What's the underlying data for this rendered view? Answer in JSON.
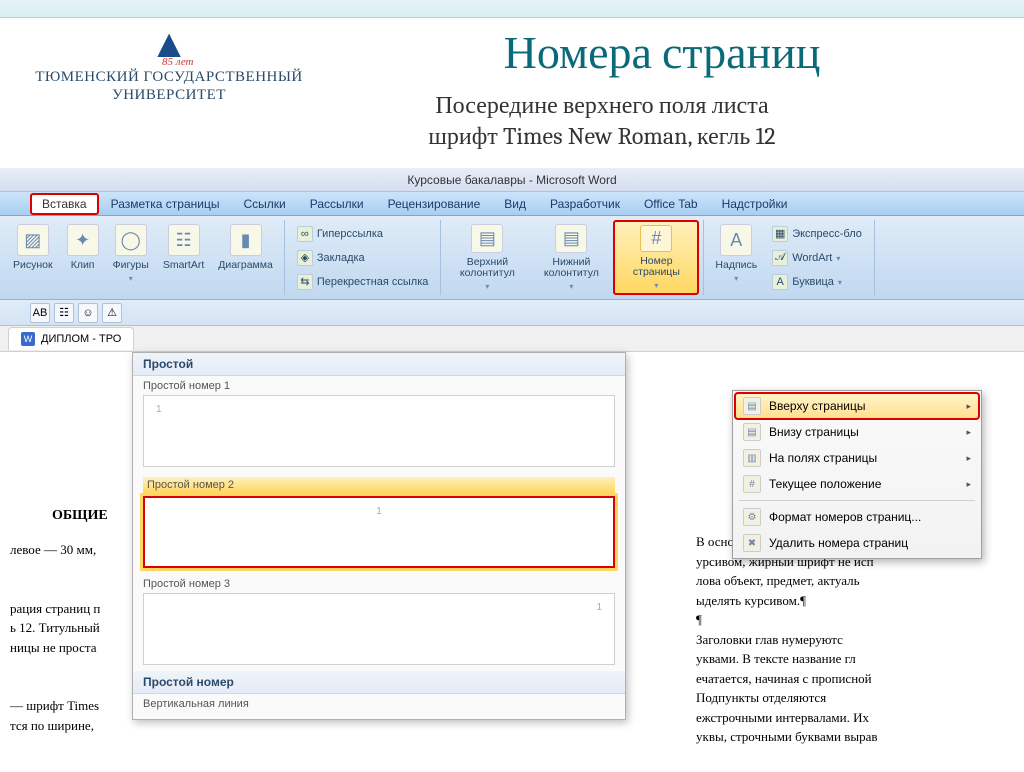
{
  "university": {
    "name_line1": "ТЮМЕНСКИЙ ГОСУДАРСТВЕННЫЙ",
    "name_line2": "УНИВЕРСИТЕТ",
    "badge": "85 лет"
  },
  "slide": {
    "title": "Номера страниц",
    "subtitle_line1": "Посередине верхнего поля листа",
    "subtitle_line2": "шрифт Times New Roman, кегль 12"
  },
  "word": {
    "title": "Курсовые бакалавры - Microsoft Word",
    "tabs": {
      "insert": "Вставка",
      "layout": "Разметка страницы",
      "references": "Ссылки",
      "mailings": "Рассылки",
      "review": "Рецензирование",
      "view": "Вид",
      "developer": "Разработчик",
      "officetab": "Office Tab",
      "addins": "Надстройки"
    },
    "ribbon": {
      "picture": "Рисунок",
      "clip": "Клип",
      "shapes": "Фигуры",
      "smartart": "SmartArt",
      "chart": "Диаграмма",
      "hyperlink": "Гиперссылка",
      "bookmark": "Закладка",
      "crossref": "Перекрестная ссылка",
      "header": "Верхний колонтитул",
      "footer": "Нижний колонтитул",
      "pagenum": "Номер страницы",
      "textbox": "Надпись",
      "express": "Экспресс-бло",
      "wordart": "WordArt",
      "dropcap": "Буквица"
    },
    "doc_tab": "ДИПЛОМ - ТРО",
    "gallery": {
      "headers": {
        "simple": "Простой",
        "simple_num": "Простой номер"
      },
      "items": {
        "n1": "Простой номер 1",
        "n2": "Простой номер 2",
        "n3": "Простой номер 3",
        "vline": "Вертикальная линия"
      }
    },
    "pn_menu": {
      "top": "Вверху страницы",
      "bottom": "Внизу страницы",
      "margins": "На полях страницы",
      "current": "Текущее положение",
      "format": "Формат номеров страниц...",
      "remove": "Удалить номера страниц"
    }
  },
  "bg": {
    "heading": "ОБЩИЕ",
    "left_lines": [
      "левое — 30 мм,",
      "",
      "рация страниц п",
      "ь 12. Титульный",
      "ницы не проста",
      "",
      "— шрифт Times",
      "тся по ширине,"
    ],
    "right_lines": [
      "В основном тексте допус",
      "урсивом, жирный шрифт не исп",
      "лова объект, предмет, актуаль",
      "ыделять курсивом.¶",
      "¶",
      "Заголовки глав нумеруютс",
      "уквами. В тексте название гл",
      "ечатается, начиная с прописной",
      "Подпункты отделяются",
      "ежстрочными интервалами. Их",
      "уквы, строчными буквами вырав"
    ]
  }
}
